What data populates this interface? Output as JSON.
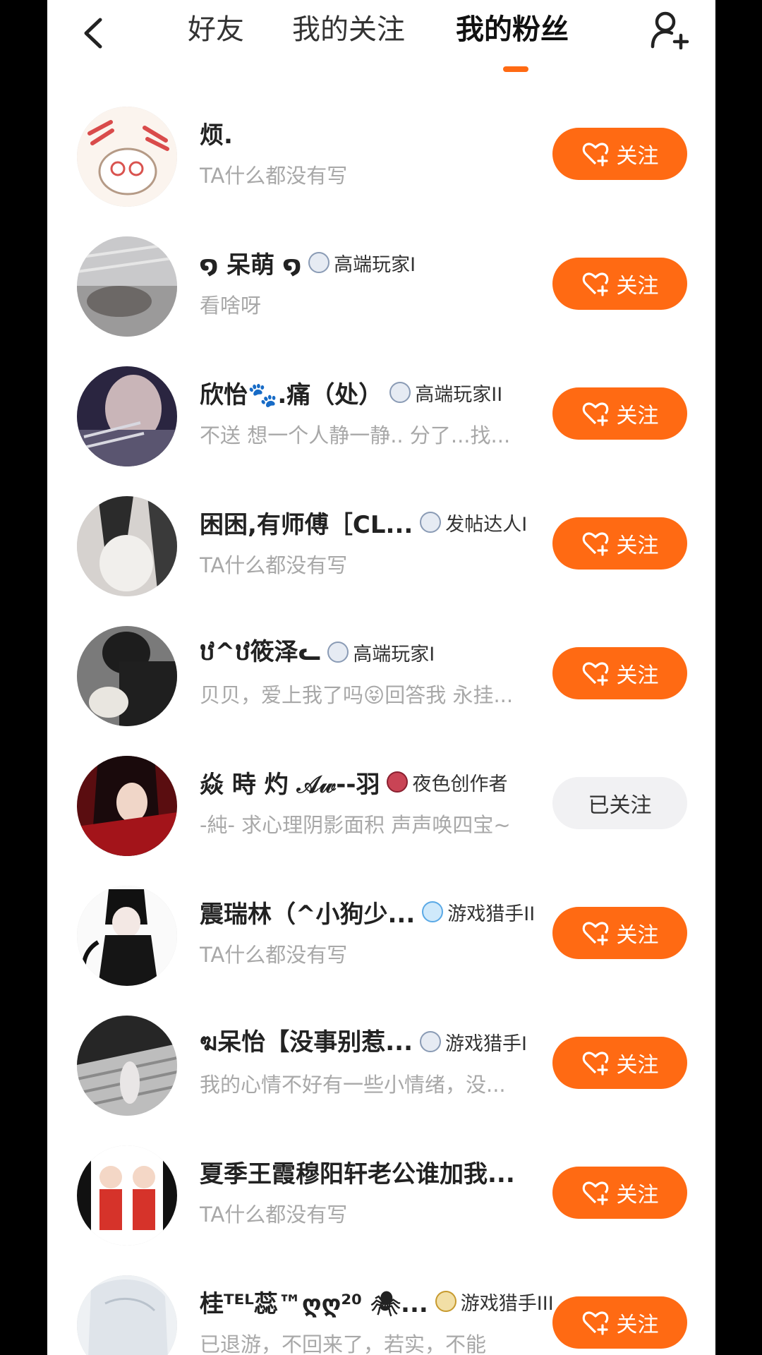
{
  "nav": {
    "tabs": [
      {
        "label": "好友"
      },
      {
        "label": "我的关注"
      },
      {
        "label": "我的粉丝"
      }
    ],
    "active_tab": "我的粉丝",
    "accent_color": "#ff6a13"
  },
  "fans": [
    {
      "name": "烦.",
      "badge": "",
      "bio": "TA什么都没有写",
      "button": "关注",
      "followed": false
    },
    {
      "name": "໑ 呆萌 ໑",
      "badge": "高端玩家I",
      "bio": "看啥呀",
      "button": "关注",
      "followed": false
    },
    {
      "name": "欣怡🐾.痛（处）",
      "badge": "高端玩家II",
      "bio": "不送 想一个人静一静.. 分了...找...",
      "button": "关注",
      "followed": false
    },
    {
      "name": "困困,有师傅［CL...",
      "badge": "发帖达人I",
      "bio": "TA什么都没有写",
      "button": "关注",
      "followed": false
    },
    {
      "name": "ឋ^ឋ筱泽ᓚ",
      "badge": "高端玩家I",
      "bio": "贝贝，爱上我了吗😝回答我 永挂...",
      "button": "关注",
      "followed": false
    },
    {
      "name": "焱 時 灼 𝒜𝓌--羽",
      "badge": "夜色创作者",
      "bio": "-純- 求心理阴影面积 声声唤四宝~",
      "button": "已关注",
      "followed": true
    },
    {
      "name": "震瑞林（^小狗少...",
      "badge": "游戏猎手II",
      "bio": "TA什么都没有写",
      "button": "关注",
      "followed": false
    },
    {
      "name": "ฆ呆怡【没事别惹...",
      "badge": "游戏猎手I",
      "bio": "我的心情不好有一些小情绪，没...",
      "button": "关注",
      "followed": false
    },
    {
      "name": "夏季王霞穆阳轩老公谁加我...",
      "badge": "",
      "bio": "TA什么都没有写",
      "button": "关注",
      "followed": false
    },
    {
      "name": "桂ᵀᴱᴸ蕊™ღღ²⁰ 🕷...",
      "badge": "游戏猎手III",
      "bio": "已退游，不回来了，若实，不能",
      "button": "关注",
      "followed": false
    }
  ]
}
